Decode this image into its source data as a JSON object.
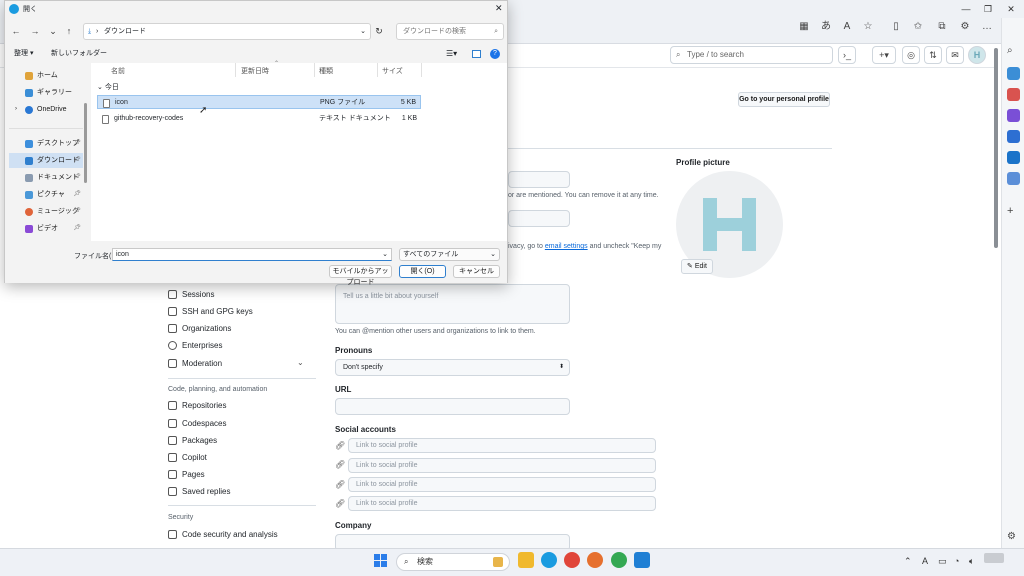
{
  "browser": {
    "search_placeholder": "Type / to search",
    "search_key": "/",
    "accent": "#0f6cbd"
  },
  "github": {
    "avatar_letter": "H",
    "personal_profile_button": "Go to your personal profile",
    "mentioned_text": "or are mentioned. You can remove it at any time.",
    "privacy_text_pre": "ivacy, go to ",
    "privacy_link": "email settings",
    "privacy_text_post": " and uncheck \"Keep my",
    "profile_picture_label": "Profile picture",
    "edit_label": "Edit",
    "bio_placeholder": "Tell us a little bit about yourself",
    "mention_hint": "You can @mention other users and organizations to link to them.",
    "pronouns_label": "Pronouns",
    "pronouns_value": "Don't specify",
    "url_label": "URL",
    "social_label": "Social accounts",
    "social_placeholder": "Link to social profile",
    "company_label": "Company",
    "nav": [
      {
        "label": "Sessions",
        "icon": "broadcast-icon"
      },
      {
        "label": "SSH and GPG keys",
        "icon": "key-icon"
      },
      {
        "label": "Organizations",
        "icon": "organization-icon"
      },
      {
        "label": "Enterprises",
        "icon": "globe-icon"
      },
      {
        "label": "Moderation",
        "icon": "report-icon"
      }
    ],
    "section_code": "Code, planning, and automation",
    "nav2": [
      {
        "label": "Repositories",
        "icon": "repo-icon"
      },
      {
        "label": "Codespaces",
        "icon": "codespaces-icon"
      },
      {
        "label": "Packages",
        "icon": "package-icon"
      },
      {
        "label": "Copilot",
        "icon": "copilot-icon"
      },
      {
        "label": "Pages",
        "icon": "browser-icon"
      },
      {
        "label": "Saved replies",
        "icon": "reply-icon"
      }
    ],
    "section_security": "Security",
    "nav3": [
      {
        "label": "Code security and analysis",
        "icon": "shield-icon"
      }
    ]
  },
  "dialog": {
    "title": "開く",
    "address": "ダウンロード",
    "search_placeholder": "ダウンロードの検索",
    "organize": "整理 ▾",
    "new_folder": "新しいフォルダー",
    "sidebar": [
      {
        "label": "ホーム",
        "color": "#e0a33a"
      },
      {
        "label": "ギャラリー",
        "color": "#3b8ed6"
      },
      {
        "label": "OneDrive",
        "color": "#2a78d4"
      },
      {
        "label": "デスクトップ",
        "color": "#3d8fdc"
      },
      {
        "label": "ダウンロード",
        "color": "#2f7fce"
      },
      {
        "label": "ドキュメント",
        "color": "#8a9bb0"
      },
      {
        "label": "ピクチャ",
        "color": "#4a98d8"
      },
      {
        "label": "ミュージック",
        "color": "#e0643a"
      },
      {
        "label": "ビデオ",
        "color": "#8a4ad6"
      }
    ],
    "columns": [
      "名前",
      "更新日時",
      "種類",
      "サイズ"
    ],
    "group": "今日",
    "files": [
      {
        "name": "icon",
        "type": "PNG ファイル",
        "size": "5 KB"
      },
      {
        "name": "github-recovery-codes",
        "type": "テキスト ドキュメント",
        "size": "1 KB"
      }
    ],
    "filename_label": "ファイル名(N):",
    "filename_value": "icon",
    "filetype_value": "すべてのファイル",
    "mobile_button": "モバイルからアップロード",
    "open_button": "開く(O)",
    "cancel_button": "キャンセル"
  },
  "taskbar": {
    "search_label": "検索",
    "lang": "A"
  }
}
